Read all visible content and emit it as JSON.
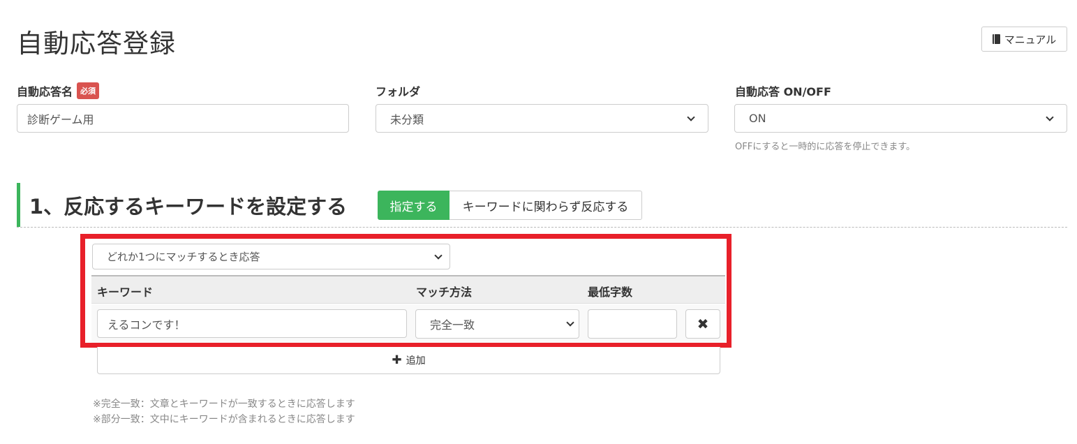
{
  "page": {
    "title": "自動応答登録",
    "manual_label": "マニュアル"
  },
  "form": {
    "name_label": "自動応答名",
    "required_badge": "必須",
    "name_value": "診断ゲーム用",
    "folder_label": "フォルダ",
    "folder_value": "未分類",
    "onoff_label": "自動応答 ON/OFF",
    "onoff_value": "ON",
    "onoff_help": "OFFにすると一時的に応答を停止できます。"
  },
  "section1": {
    "title": "1、反応するキーワードを設定する",
    "toggle_specify": "指定する",
    "toggle_any": "キーワードに関わらず反応する"
  },
  "keywords": {
    "match_mode": "どれか1つにマッチするとき応答",
    "columns": [
      "キーワード",
      "マッチ方法",
      "最低字数"
    ],
    "rows": [
      {
        "keyword": "えるコンです！",
        "method": "完全一致",
        "min_chars": ""
      }
    ],
    "delete_glyph": "✖",
    "add_label": "追加"
  },
  "notes": [
    "※完全一致：文章とキーワードが一致するときに応答します",
    "※部分一致：文中にキーワードが含まれるときに応答します"
  ],
  "colors": {
    "accent_green": "#3cb55c",
    "highlight_red": "#e8202a",
    "required_red": "#d9534f"
  },
  "icons": {
    "manual": "book-icon",
    "select": "chevron-down-icon",
    "delete": "close-icon",
    "add": "plus-icon"
  }
}
